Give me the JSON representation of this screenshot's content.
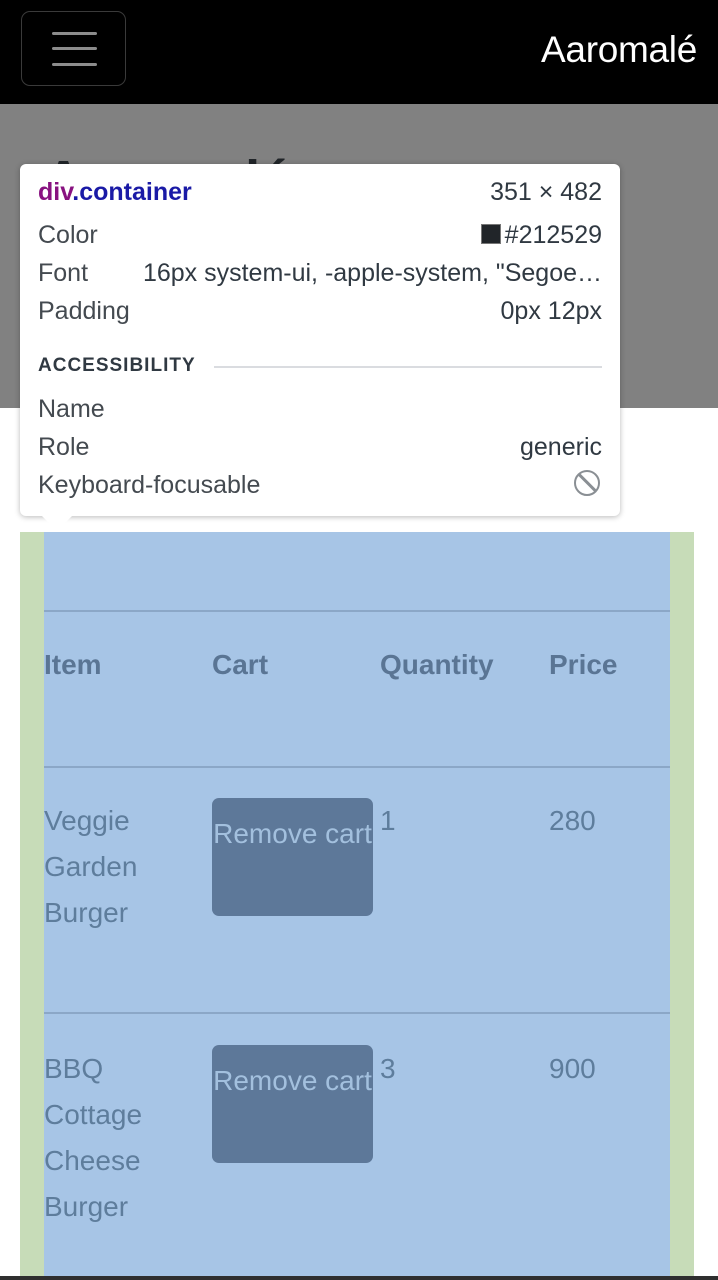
{
  "navbar": {
    "brand": "Aaromalé",
    "toggler_icon": "hamburger-menu-icon"
  },
  "hero": {
    "title": "Aaromalé"
  },
  "table": {
    "headers": [
      "Item",
      "Cart",
      "Quantity",
      "Price"
    ],
    "rows": [
      {
        "item": "Veggie Garden Burger",
        "button": "Remove cart",
        "quantity": "1",
        "price": "280"
      },
      {
        "item": "BBQ Cottage Cheese Burger",
        "button": "Remove cart",
        "quantity": "3",
        "price": "900"
      }
    ]
  },
  "inspector": {
    "tag": "div",
    "class": ".container",
    "dimensions": "351 × 482",
    "color_label": "Color",
    "color_value": "#212529",
    "font_label": "Font",
    "font_value": "16px system-ui, -apple-system, \"Segoe…",
    "padding_label": "Padding",
    "padding_value": "0px 12px",
    "accessibility_heading": "ACCESSIBILITY",
    "name_label": "Name",
    "role_label": "Role",
    "role_value": "generic",
    "focusable_label": "Keyboard-focusable",
    "focusable_icon": "not-allowed-icon"
  },
  "colors": {
    "navbar_bg": "#000000",
    "hero_bg": "#818181",
    "content_highlight": "#a7c5e6",
    "padding_highlight": "#c7dcb8",
    "button_bg": "#5d7899"
  }
}
